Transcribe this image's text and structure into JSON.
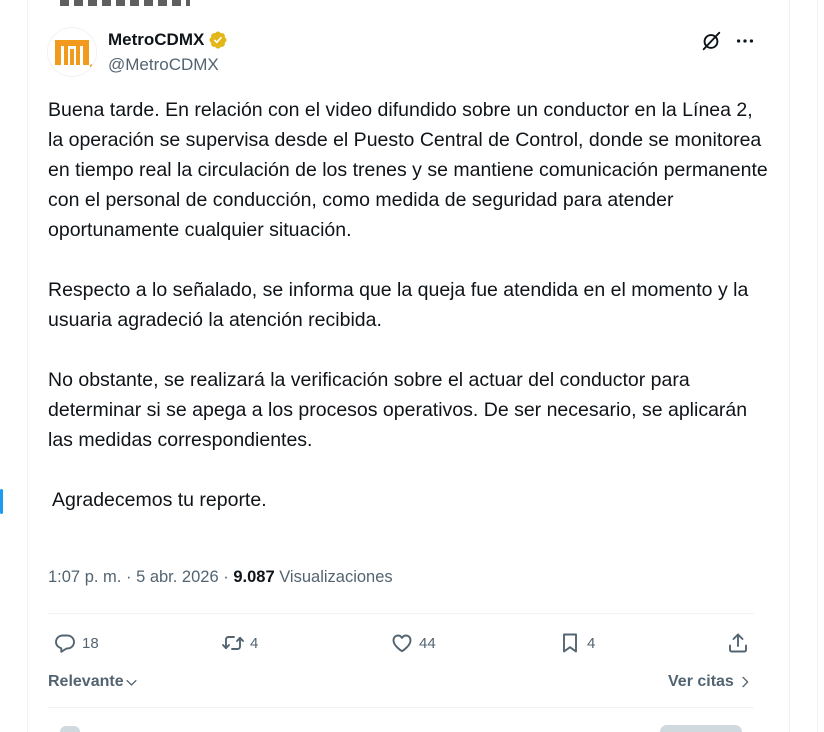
{
  "account": {
    "display_name": "MetroCDMX",
    "handle": "@MetroCDMX",
    "verified_color": "#e2b719",
    "logo_color": "#f29a1e"
  },
  "post": {
    "paragraphs": [
      "Buena tarde. En relación con el video difundido sobre un conductor en la Línea 2, la operación se supervisa desde el Puesto Central de Control, donde se monitorea en tiempo real la circulación de los trenes y se mantiene comunicación permanente con el personal de conducción, como medida de seguridad para atender oportunamente cualquier situación.",
      "Respecto a lo señalado, se informa que la queja fue atendida en el momento y la usuaria agradeció la atención recibida.",
      "No obstante, se realizará la verificación sobre el actuar del conductor para determinar si se apega a los procesos operativos. De ser necesario, se aplicarán las medidas correspondientes.",
      "Agradecemos tu reporte."
    ],
    "time": "1:07 p. m.",
    "date": "5 abr. 2026",
    "separator": "·",
    "views_count": "9.087",
    "views_label": "Visualizaciones"
  },
  "actions": {
    "replies": "18",
    "reposts": "4",
    "likes": "44",
    "bookmarks": "4"
  },
  "icons": {
    "grok": "grok-icon",
    "more": "more-icon",
    "reply": "reply-icon",
    "repost": "repost-icon",
    "like": "heart-icon",
    "bookmark": "bookmark-icon",
    "share": "share-icon"
  },
  "sort": {
    "label": "Relevante",
    "quotes_label": "Ver citas"
  }
}
